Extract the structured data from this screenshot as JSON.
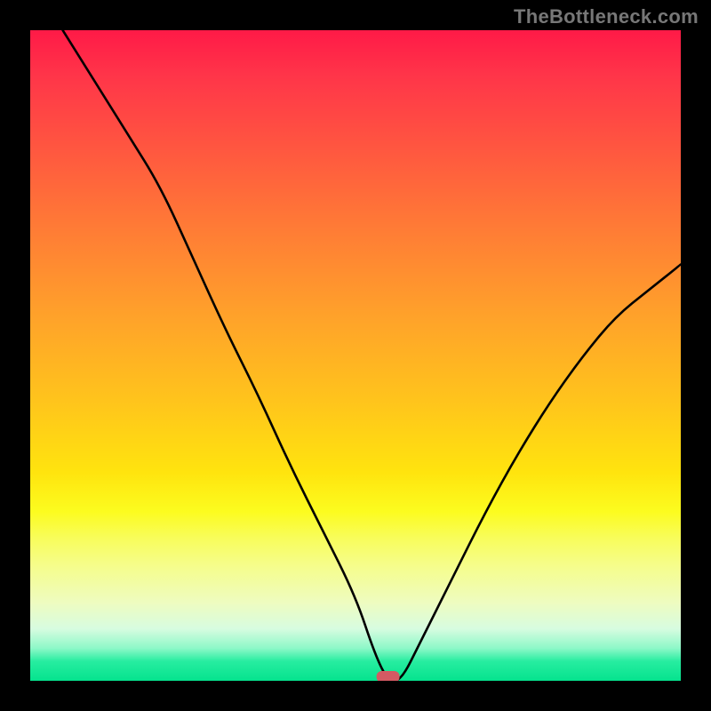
{
  "watermark": "TheBottleneck.com",
  "chart_data": {
    "type": "line",
    "title": "",
    "xlabel": "",
    "ylabel": "",
    "legend": false,
    "grid": false,
    "xlim": [
      0,
      100
    ],
    "ylim": [
      0,
      100
    ],
    "annotations": [
      {
        "name": "match-marker",
        "x": 55,
        "y": 0,
        "shape": "rounded-rect",
        "color": "#d45a63"
      }
    ],
    "background_gradient": {
      "orientation": "vertical",
      "stops": [
        {
          "pos": 0,
          "color": "#ff1a47"
        },
        {
          "pos": 50,
          "color": "#ffc41c"
        },
        {
          "pos": 75,
          "color": "#fcfc1f"
        },
        {
          "pos": 100,
          "color": "#05e38e"
        }
      ]
    },
    "series": [
      {
        "name": "bottleneck-curve",
        "x": [
          5,
          10,
          15,
          20,
          25,
          30,
          35,
          40,
          45,
          50,
          53,
          55,
          57,
          60,
          65,
          70,
          75,
          80,
          85,
          90,
          95,
          100
        ],
        "values": [
          100,
          92,
          84,
          76,
          65,
          54,
          44,
          33,
          23,
          13,
          4,
          0,
          0,
          6,
          16,
          26,
          35,
          43,
          50,
          56,
          60,
          64
        ]
      }
    ]
  },
  "colors": {
    "curve": "#000000",
    "frame": "#000000",
    "watermark": "#777777",
    "marker": "#d45a63"
  }
}
